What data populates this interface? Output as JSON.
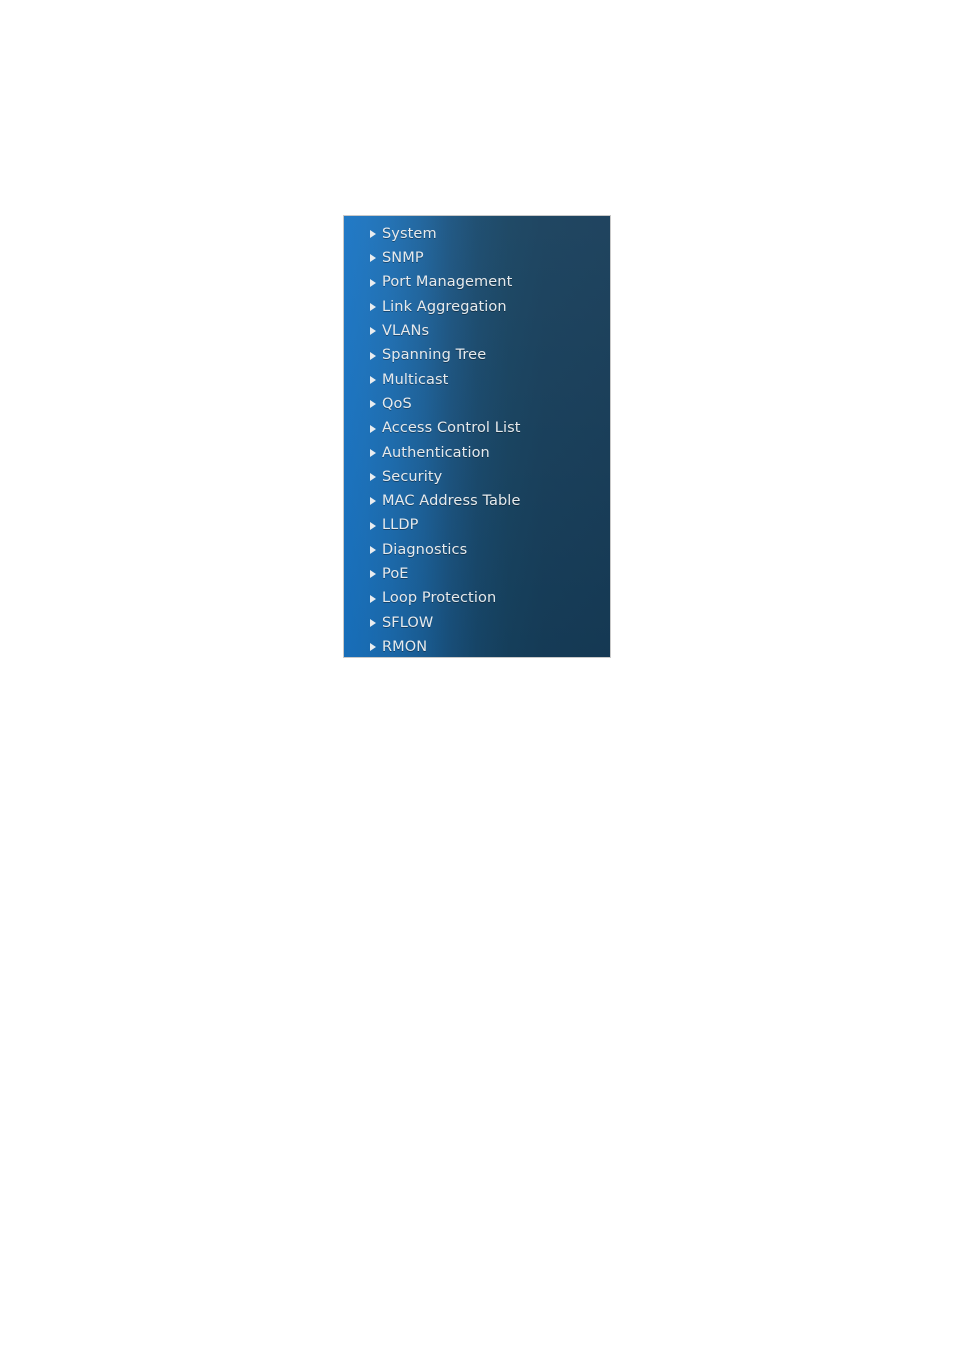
{
  "page": {
    "background_color": "#ffffff"
  },
  "nav_panel": {
    "name": "switch-configuration-menu",
    "border_color": "#c9c9c9",
    "gradient_from": "#1874c4",
    "gradient_to": "#163c58",
    "text_color": "#e6eaed",
    "bullet_icon": "triangle-right-icon",
    "bullet_color": "#e9edf0",
    "items": [
      {
        "label": "System"
      },
      {
        "label": "SNMP"
      },
      {
        "label": "Port Management"
      },
      {
        "label": "Link Aggregation"
      },
      {
        "label": "VLANs"
      },
      {
        "label": "Spanning Tree"
      },
      {
        "label": "Multicast"
      },
      {
        "label": "QoS"
      },
      {
        "label": "Access Control List"
      },
      {
        "label": "Authentication"
      },
      {
        "label": "Security"
      },
      {
        "label": "MAC Address Table"
      },
      {
        "label": "LLDP"
      },
      {
        "label": "Diagnostics"
      },
      {
        "label": "PoE"
      },
      {
        "label": "Loop Protection"
      },
      {
        "label": "SFLOW"
      },
      {
        "label": "RMON"
      }
    ]
  }
}
